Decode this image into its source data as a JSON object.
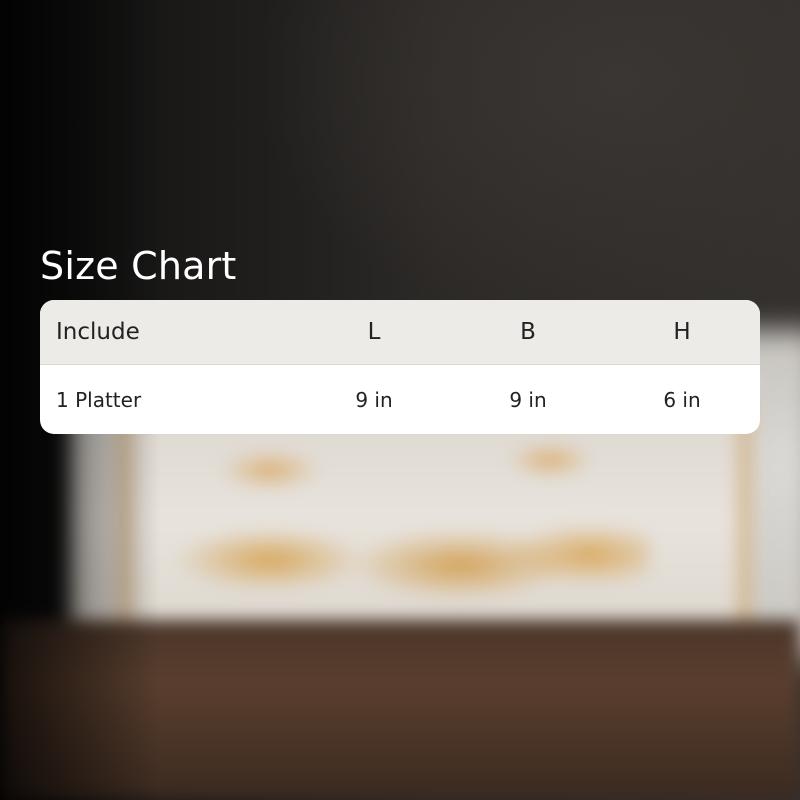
{
  "title": "Size Chart",
  "table": {
    "headers": [
      "Include",
      "L",
      "B",
      "H"
    ],
    "rows": [
      [
        "1 Platter",
        "9 in",
        "9 in",
        "6 in"
      ]
    ]
  },
  "colors": {
    "card_background": "#ffffff",
    "header_background": "#ecebe7",
    "title_text": "#ffffff",
    "cell_text": "#222222"
  }
}
